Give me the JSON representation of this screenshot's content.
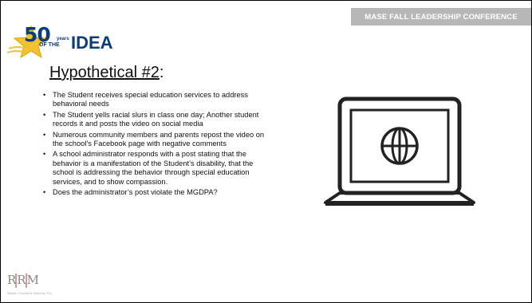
{
  "header": {
    "conference_banner": "MASE FALL LEADERSHIP CONFERENCE"
  },
  "logo": {
    "number": "50",
    "years": "years",
    "of_the": "OF THE",
    "name": "IDEA"
  },
  "slide": {
    "title": "Hypothetical #2",
    "title_suffix": ":",
    "bullets": [
      "The Student receives special education services to address behavioral needs",
      "The Student yells racial slurs in class one day; Another student records it and posts the video on social media",
      "Numerous community members and parents repost the video on the school’s Facebook page with negative comments",
      "A school administrator responds with a post stating that the behavior is a manifestation of the Student’s disability, that the school is addressing the behavior through special education services, and to show compassion.",
      "Does the administrator’s post violate the MGDPA?"
    ]
  },
  "footer_logo": {
    "letters": "RRM",
    "firm_name": "Ratwik, Roszak & Maloney, P.A."
  },
  "colors": {
    "banner_bg": "#b7b7b7",
    "logo_blue": "#0a3d7a",
    "logo_gold": "#f2c230"
  },
  "icons": {
    "laptop": "laptop-globe-icon"
  }
}
